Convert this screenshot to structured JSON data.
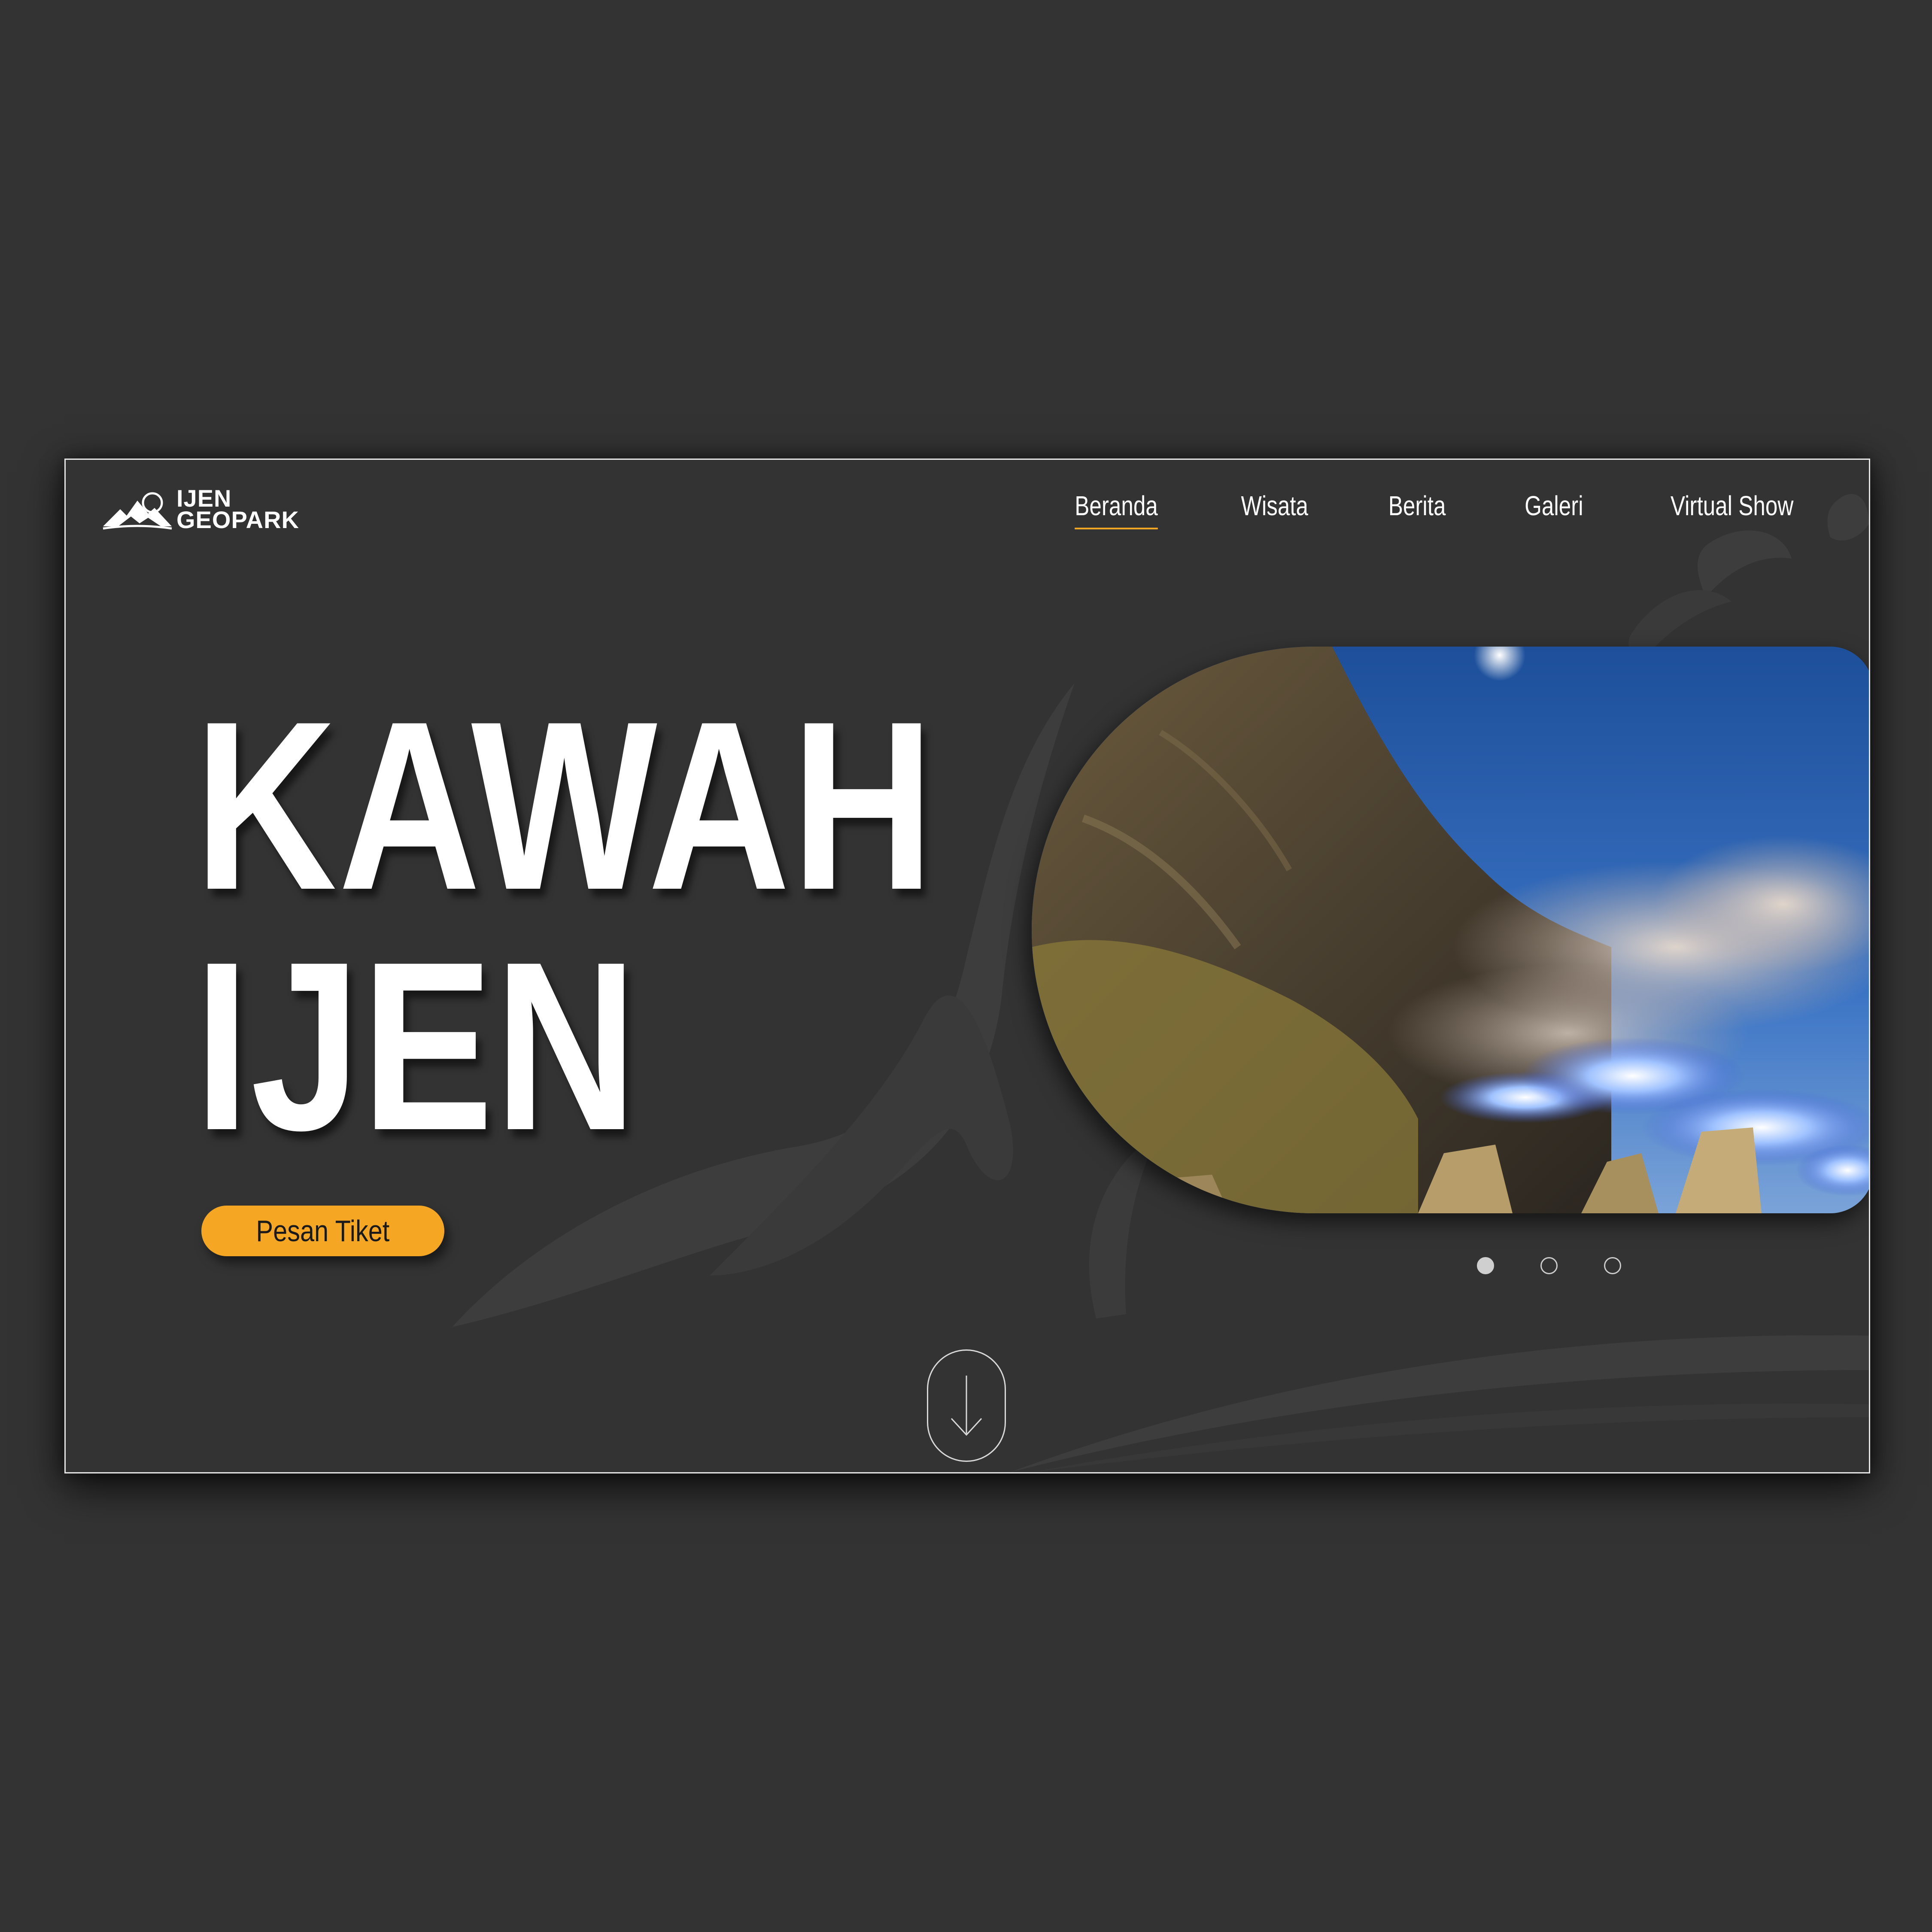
{
  "brand": {
    "line1": "IJEN",
    "line2": "GEOPARK",
    "logo_icon": "mountain-sun-icon"
  },
  "nav": {
    "items": [
      {
        "label": "Beranda",
        "active": true
      },
      {
        "label": "Wisata",
        "active": false
      },
      {
        "label": "Berita",
        "active": false
      },
      {
        "label": "Galeri",
        "active": false
      },
      {
        "label": "Virtual Show",
        "active": false
      }
    ]
  },
  "hero": {
    "title_line1": "KAWAH",
    "title_line2": "IJEN",
    "cta_label": "Pesan Tiket",
    "image_subject": "blue-fire-crater-photo",
    "slides": {
      "count": 3,
      "active_index": 0
    }
  },
  "scroll": {
    "icon": "arrow-down-icon"
  },
  "colors": {
    "background": "#333333",
    "accent": "#f5a623",
    "text": "#ffffff",
    "frame_border": "#e6e6e6"
  }
}
